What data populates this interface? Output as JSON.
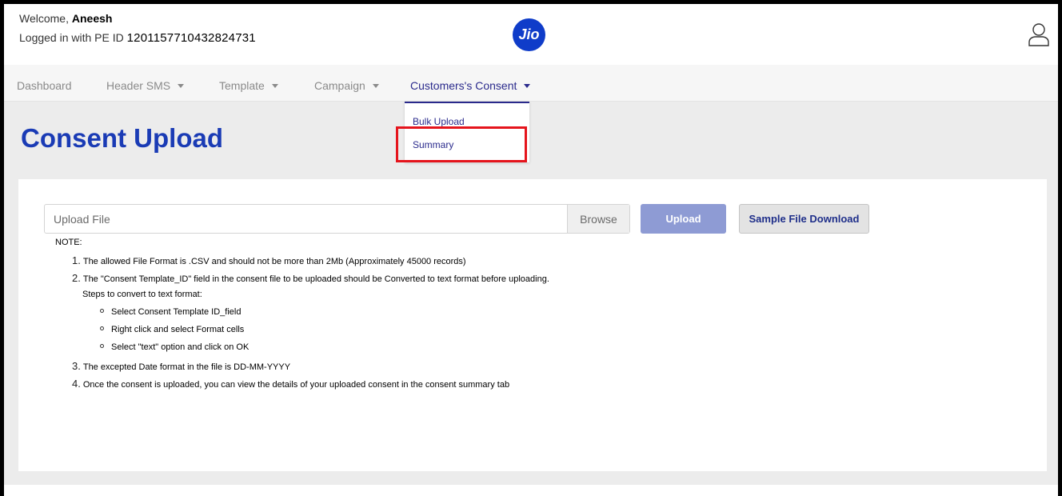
{
  "header": {
    "welcome_prefix": "Welcome,",
    "user_name": "Aneesh",
    "pe_prefix": "Logged in with PE ID",
    "pe_id": "1201157710432824731",
    "logo_text": "Jio",
    "user_icon": "user-icon"
  },
  "nav": {
    "items": [
      {
        "label": "Dashboard"
      },
      {
        "label": "Header SMS"
      },
      {
        "label": "Template"
      },
      {
        "label": "Campaign"
      },
      {
        "label": "Customers's Consent"
      }
    ]
  },
  "dropdown": {
    "items": [
      {
        "label": "Bulk Upload"
      },
      {
        "label": "Summary"
      }
    ]
  },
  "page": {
    "title": "Consent Upload"
  },
  "upload": {
    "placeholder": "Upload File",
    "browse_label": "Browse",
    "upload_label": "Upload",
    "sample_label": "Sample File Download"
  },
  "notes": {
    "label": "NOTE:",
    "items": [
      {
        "num": "1.",
        "text": "The allowed File Format is .CSV and should not be more than 2Mb (Approximately 45000 records)"
      },
      {
        "num": "2.",
        "text": "The \"Consent Template_ID\" field in the consent file to be uploaded should be Converted to text format before uploading."
      },
      {
        "num": "3.",
        "text": "The excepted Date format in the file is DD-MM-YYYY"
      },
      {
        "num": "4.",
        "text": "Once the consent is uploaded, you can view the details of your uploaded consent in the consent summary tab"
      }
    ],
    "steps_label": "Steps to convert to text format:",
    "steps": [
      "Select Consent Template ID_field",
      "Right click and select Format cells",
      "Select \"text\" option and click on OK"
    ]
  },
  "colors": {
    "brand": "#0f3cc9",
    "title": "#1a3bb5",
    "nav_active": "#2a2a8c",
    "upload_button": "#8e9bd4",
    "highlight": "#e5141c"
  }
}
